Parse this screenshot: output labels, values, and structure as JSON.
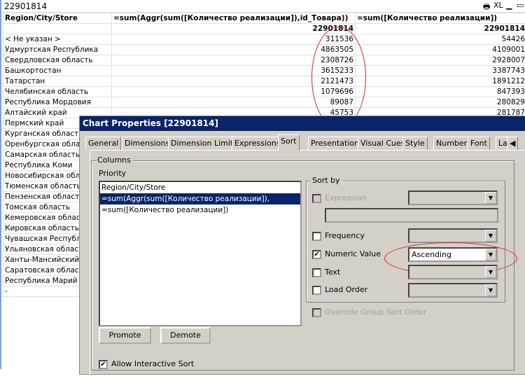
{
  "caption": {
    "title": "22901814",
    "icons": [
      "print-icon",
      "xl-icon",
      "minimize-icon",
      "maximize-icon"
    ],
    "xl": "XL"
  },
  "table": {
    "headers": [
      "Region/City/Store",
      "=sum(Aggr(sum([Количество реализации]),id_Товара))",
      "=sum([Количество реализации])"
    ],
    "totals": [
      "",
      "22901814",
      "22901814"
    ],
    "rows": [
      [
        "< Не указан >",
        "311536",
        "54426"
      ],
      [
        "Удмуртская Республика",
        "4863505",
        "4109001"
      ],
      [
        "Свердловская область",
        "2308726",
        "2928007"
      ],
      [
        "Башкортостан",
        "3615233",
        "3387743"
      ],
      [
        "Татарстан",
        "2121473",
        "1891212"
      ],
      [
        "Челябинская область",
        "1079696",
        "847393"
      ],
      [
        "Республика Мордовия",
        "89087",
        "280829"
      ],
      [
        "Алтайский край",
        "45753",
        "281787"
      ],
      [
        "Пермский край",
        "",
        ""
      ],
      [
        "Курганская область",
        "",
        ""
      ],
      [
        "Оренбургская область",
        "",
        ""
      ],
      [
        "Самарская область",
        "",
        ""
      ],
      [
        "Республика Коми",
        "",
        ""
      ],
      [
        "Новосибирская область",
        "",
        ""
      ],
      [
        "Тюменская область",
        "",
        ""
      ],
      [
        "Пензенская область",
        "",
        ""
      ],
      [
        "Томская область",
        "",
        ""
      ],
      [
        "Кемеровская область",
        "",
        ""
      ],
      [
        "Кировская область",
        "",
        ""
      ],
      [
        "Чувашская Республика",
        "",
        ""
      ],
      [
        "Ульяновская область",
        "",
        ""
      ],
      [
        "Ханты-Мансийский АО",
        "",
        ""
      ],
      [
        "Саратовская область",
        "",
        ""
      ],
      [
        "Республика Марий Эл",
        "",
        ""
      ],
      [
        "-",
        "",
        ""
      ]
    ]
  },
  "dialog": {
    "title": "Chart Properties [22901814]",
    "tabs": [
      "General",
      "Dimensions",
      "Dimension Limits",
      "Expressions",
      "Sort",
      "Presentation",
      "Visual Cues",
      "Style",
      "Number",
      "Font",
      "La"
    ],
    "active_tab": "Sort",
    "columns_label": "Columns",
    "priority_label": "Priority",
    "priority": [
      "Region/City/Store",
      "=sum(Aggr(sum([Количество реализации]), id_Товара))",
      "=sum([Количество реализации])"
    ],
    "sort_by_label": "Sort by",
    "expression": "Expression",
    "frequency": "Frequency",
    "numeric_value": "Numeric Value",
    "numeric_value_order": "Ascending",
    "text": "Text",
    "load_order": "Load Order",
    "override": "Override Group Sort Order",
    "promote": "Promote",
    "demote": "Demote",
    "allow_interactive": "Allow Interactive Sort",
    "accent": "#0a246a"
  }
}
